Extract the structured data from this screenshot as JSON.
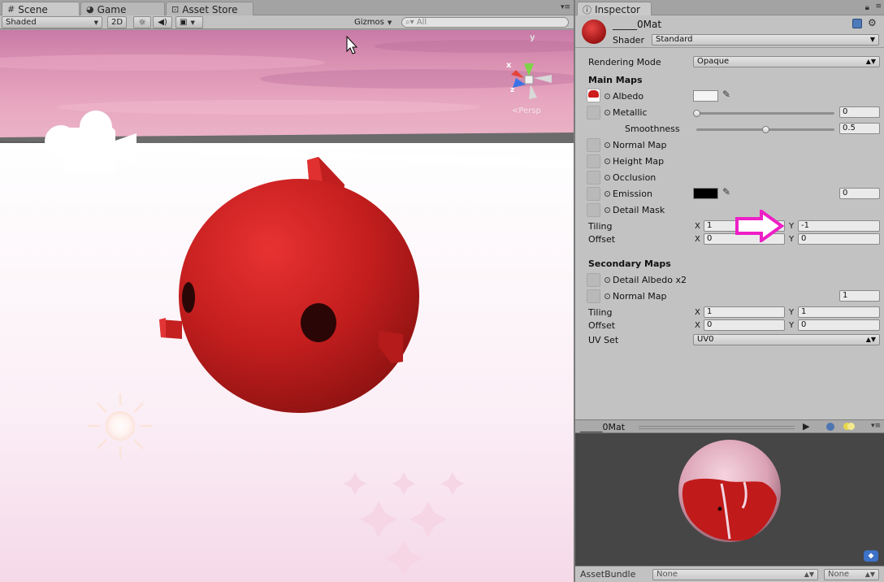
{
  "scene_panel": {
    "tabs": [
      {
        "label": "Scene",
        "icon": "grid-icon"
      },
      {
        "label": "Game",
        "icon": "pacman-icon"
      },
      {
        "label": "Asset Store",
        "icon": "bag-icon"
      }
    ],
    "toolbar": {
      "shading_mode": "Shaded",
      "mode_2d": "2D",
      "gizmos_label": "Gizmos",
      "search_placeholder": "All"
    },
    "gizmo": {
      "y_label": "y",
      "x_label": "x",
      "z_label": "z",
      "persp_label": "Persp"
    }
  },
  "inspector": {
    "tab_label": "Inspector",
    "material_name": "_____0Mat",
    "shader_label": "Shader",
    "shader_value": "Standard",
    "rendering_mode_label": "Rendering Mode",
    "rendering_mode_value": "Opaque",
    "main_maps": {
      "title": "Main Maps",
      "albedo": "Albedo",
      "metallic": "Metallic",
      "metallic_value": "0",
      "metallic_level": 0.0,
      "smoothness": "Smoothness",
      "smoothness_value": "0.5",
      "smoothness_level": 0.5,
      "normal_map": "Normal Map",
      "height_map": "Height Map",
      "occlusion": "Occlusion",
      "emission": "Emission",
      "emission_value": "0",
      "detail_mask": "Detail Mask",
      "tiling_label": "Tiling",
      "tiling_x": "1",
      "tiling_y": "-1",
      "offset_label": "Offset",
      "offset_x": "0",
      "offset_y": "0",
      "x_label": "X",
      "y_label": "Y"
    },
    "secondary_maps": {
      "title": "Secondary Maps",
      "detail_albedo": "Detail Albedo x2",
      "normal_map": "Normal Map",
      "normal_map_value": "1",
      "tiling_label": "Tiling",
      "tiling_x": "1",
      "tiling_y": "1",
      "offset_label": "Offset",
      "offset_x": "0",
      "offset_y": "0",
      "uv_set_label": "UV Set",
      "uv_set_value": "UV0"
    }
  },
  "preview": {
    "title": "_____0Mat"
  },
  "asset_bundle": {
    "label": "AssetBundle",
    "bundle_value": "None",
    "variant_value": "None"
  },
  "colors": {
    "highlight_arrow": "#ee1fc6",
    "material_red": "#b01818"
  }
}
